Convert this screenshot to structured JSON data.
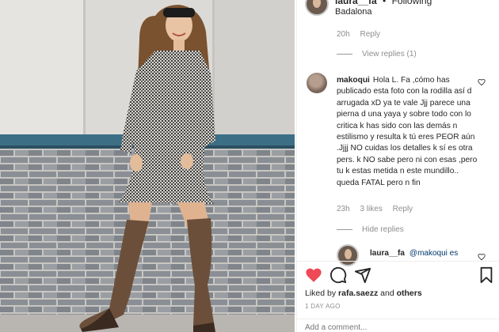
{
  "post": {
    "username": "laura__fa",
    "follow_status": "Following",
    "location": "Badalona",
    "photo_alt": "Woman in checked dress and brown knee boots against a brick wall"
  },
  "first_comment": {
    "time": "20h",
    "reply_label": "Reply",
    "view_replies": "View replies (1)"
  },
  "comment": {
    "username": "makoqui",
    "text": "Hola L. Fa ,cómo has publicado esta foto con la rodilla así d arrugada xD ya te vale Jjj parece una pierna d una yaya y sobre todo con lo critica k has sido con las demás n estilismo y resulta k tú eres PEOR aún .Jjjj NO cuidas los detalles k sí es otra pers. k NO sabe pero ni con esas ,pero tu k estas metida n este mundillo.. queda FATAL pero n fin",
    "time": "23h",
    "likes": "3 likes",
    "reply_label": "Reply",
    "hide_replies": "Hide replies"
  },
  "reply": {
    "username": "laura__fa",
    "text": "@makoqui es"
  },
  "likes": {
    "prefix": "Liked by",
    "user": "rafa.saezz",
    "and": "and",
    "others": "others"
  },
  "time_ago": "1 DAY AGO",
  "add_comment_placeholder": "Add a comment...",
  "icons": [
    "heart-filled-icon",
    "comment-icon",
    "share-icon",
    "bookmark-icon",
    "heart-outline-icon"
  ],
  "colors": {
    "like_red": "#ed4956",
    "text": "#262626",
    "muted": "#8e8e8e",
    "link": "#00376b"
  }
}
